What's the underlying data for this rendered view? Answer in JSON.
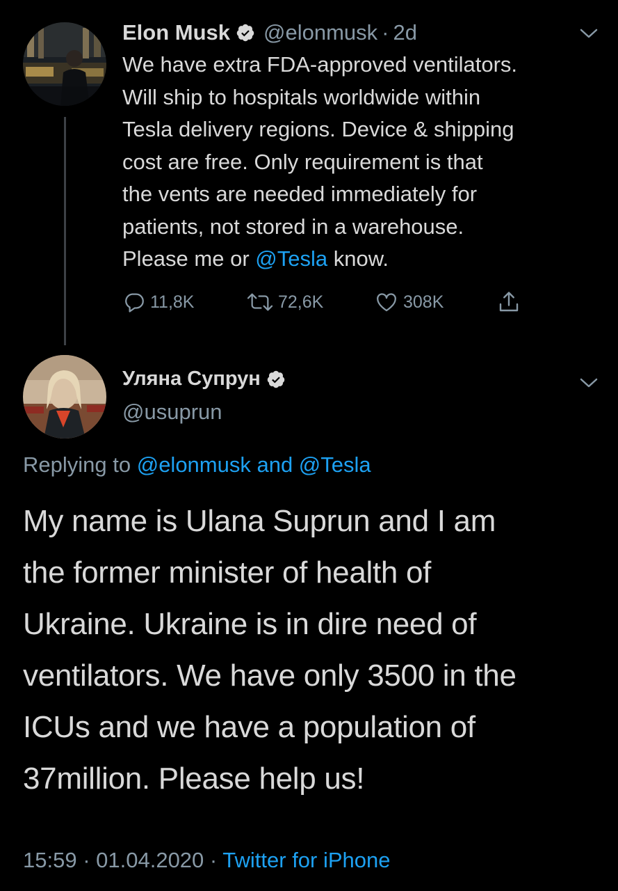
{
  "colors": {
    "background": "#000000",
    "text_primary": "#d9d9d9",
    "text_secondary": "#8899a6",
    "link": "#1da1f2",
    "thread_line": "#3d4146"
  },
  "tweet1": {
    "display_name": "Elon Musk",
    "verified_icon": "verified-badge-icon",
    "handle": "@elonmusk",
    "separator": "·",
    "time": "2d",
    "text_lines": [
      "We have extra FDA-approved ventilators.",
      "Will ship to hospitals worldwide within",
      "Tesla delivery regions. Device & shipping",
      "cost are free. Only requirement is that",
      "the vents are needed immediately for",
      "patients, not stored in a warehouse."
    ],
    "last_line_before": "Please me or ",
    "last_line_mention": "@Tesla",
    "last_line_after": " know.",
    "menu_icon": "chevron-down-icon",
    "actions": {
      "reply_icon": "reply-icon",
      "reply_count": "11,8K",
      "retweet_icon": "retweet-icon",
      "retweet_count": "72,6K",
      "like_icon": "heart-icon",
      "like_count": "308K",
      "share_icon": "share-icon"
    }
  },
  "tweet2": {
    "display_name": "Уляна Супрун",
    "verified_icon": "verified-badge-icon",
    "handle": "@usuprun",
    "menu_icon": "chevron-down-icon",
    "replying_prefix": "Replying to ",
    "replying_mentions": "@elonmusk and @Tesla",
    "text_lines": [
      "My name is Ulana Suprun and I am",
      "the former minister of health of",
      "Ukraine. Ukraine is in dire need of",
      "ventilators. We have only 3500 in the",
      "ICUs and we have a population of",
      "37million. Please help us!"
    ],
    "time": "15:59",
    "separator": " · ",
    "date": "01.04.2020",
    "source": "Twitter for iPhone"
  }
}
